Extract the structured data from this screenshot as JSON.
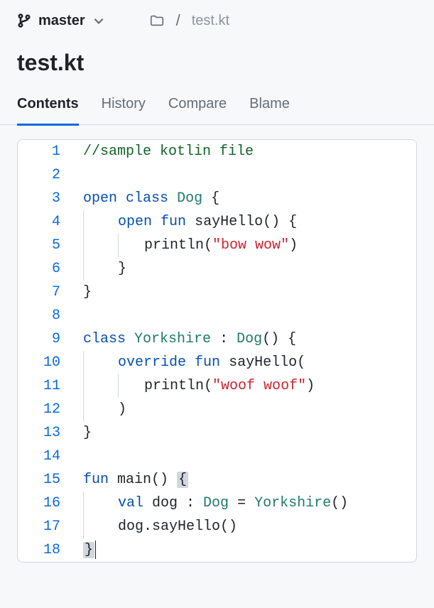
{
  "branch": {
    "name": "master"
  },
  "breadcrumb": {
    "file": "test.kt"
  },
  "title": "test.kt",
  "tabs": {
    "contents": "Contents",
    "history": "History",
    "compare": "Compare",
    "blame": "Blame"
  },
  "code": {
    "line1": {
      "num": "1",
      "comment": "//sample kotlin file"
    },
    "line2": {
      "num": "2"
    },
    "line3": {
      "num": "3",
      "kw_open": "open",
      "kw_class": "class",
      "type": "Dog",
      "brace": " {"
    },
    "line4": {
      "num": "4",
      "kw_open": "open",
      "kw_fun": "fun",
      "ident": " sayHello() {"
    },
    "line5": {
      "num": "5",
      "ident": "println(",
      "str": "\"bow wow\"",
      "end": ")"
    },
    "line6": {
      "num": "6",
      "brace": "}"
    },
    "line7": {
      "num": "7",
      "brace": "}"
    },
    "line8": {
      "num": "8"
    },
    "line9": {
      "num": "9",
      "kw_class": "class",
      "type1": "Yorkshire",
      "colon": " : ",
      "type2": "Dog",
      "end": "() {"
    },
    "line10": {
      "num": "10",
      "kw_override": "override",
      "kw_fun": "fun",
      "ident": " sayHello("
    },
    "line11": {
      "num": "11",
      "ident": "println(",
      "str": "\"woof woof\"",
      "end": ")"
    },
    "line12": {
      "num": "12",
      "paren": ")"
    },
    "line13": {
      "num": "13",
      "brace": "}"
    },
    "line14": {
      "num": "14"
    },
    "line15": {
      "num": "15",
      "kw_fun": "fun",
      "ident": " main() ",
      "brace": "{"
    },
    "line16": {
      "num": "16",
      "kw_val": "val",
      "ident1": " dog : ",
      "type1": "Dog",
      "eq": " = ",
      "type2": "Yorkshire",
      "end": "()"
    },
    "line17": {
      "num": "17",
      "ident": "dog.sayHello()"
    },
    "line18": {
      "num": "18",
      "brace": "}"
    }
  }
}
